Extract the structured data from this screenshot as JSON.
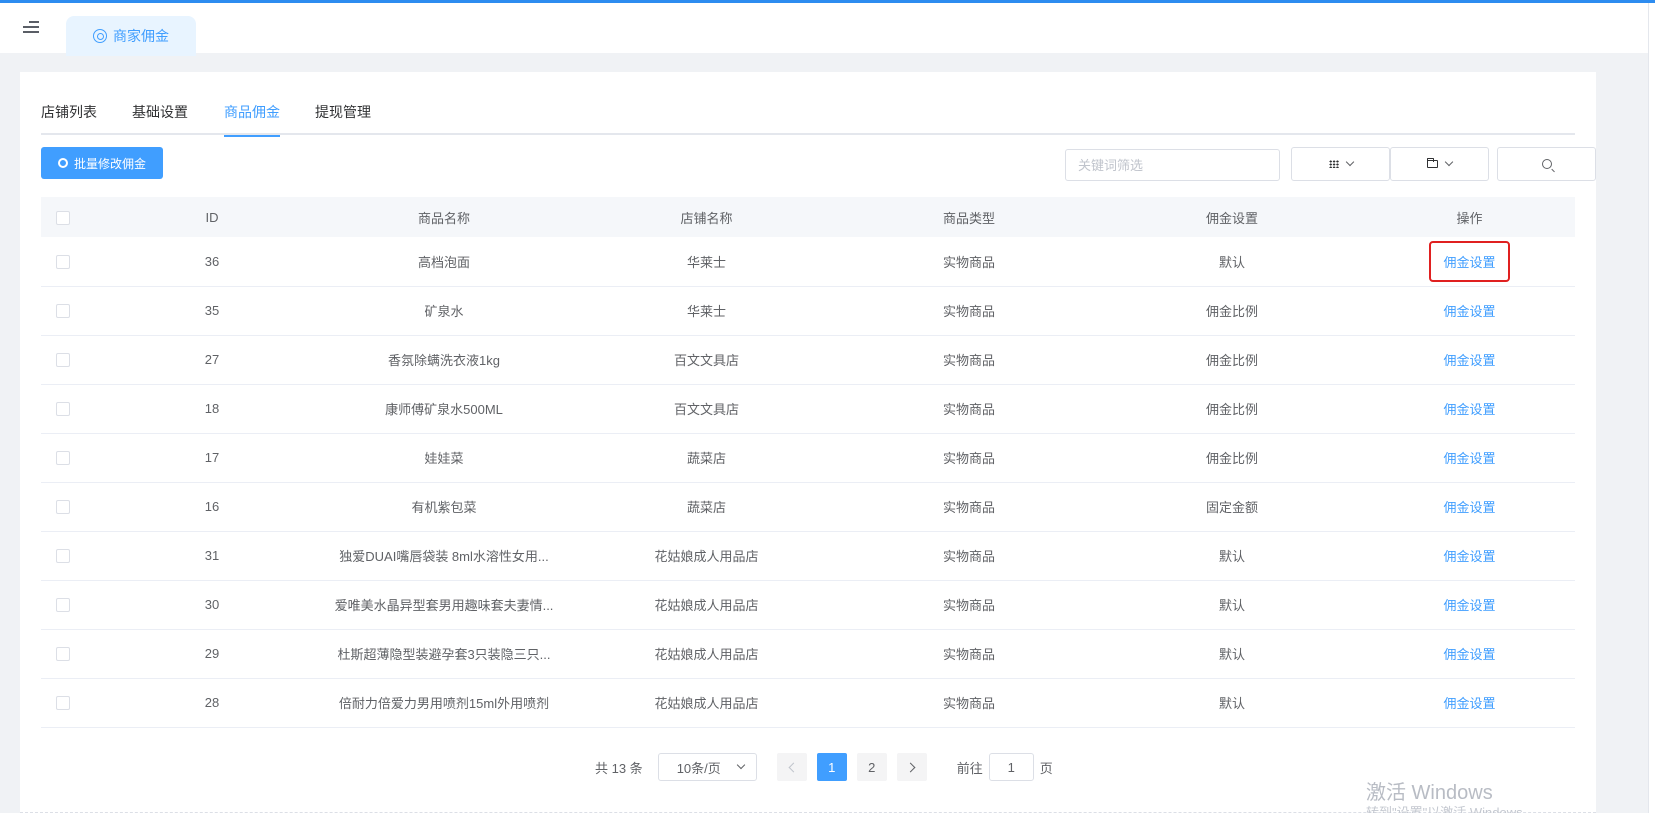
{
  "header": {
    "active_tab": "商家佣金"
  },
  "tabs": [
    "店铺列表",
    "基础设置",
    "商品佣金",
    "提现管理"
  ],
  "toolbar": {
    "batch_label": "批量修改佣金",
    "search_placeholder": "关键词筛选"
  },
  "table": {
    "columns": [
      "ID",
      "商品名称",
      "店铺名称",
      "商品类型",
      "佣金设置",
      "操作"
    ],
    "action_label": "佣金设置",
    "rows": [
      {
        "id": "36",
        "name": "高档泡面",
        "shop": "华莱士",
        "type": "实物商品",
        "commission": "默认"
      },
      {
        "id": "35",
        "name": "矿泉水",
        "shop": "华莱士",
        "type": "实物商品",
        "commission": "佣金比例"
      },
      {
        "id": "27",
        "name": "香氛除螨洗衣液1kg",
        "shop": "百文文具店",
        "type": "实物商品",
        "commission": "佣金比例"
      },
      {
        "id": "18",
        "name": "康师傅矿泉水500ML",
        "shop": "百文文具店",
        "type": "实物商品",
        "commission": "佣金比例"
      },
      {
        "id": "17",
        "name": "娃娃菜",
        "shop": "蔬菜店",
        "type": "实物商品",
        "commission": "佣金比例"
      },
      {
        "id": "16",
        "name": "有机紫包菜",
        "shop": "蔬菜店",
        "type": "实物商品",
        "commission": "固定金额"
      },
      {
        "id": "31",
        "name": "独爱DUAI嘴唇袋装 8ml水溶性女用...",
        "shop": "花姑娘成人用品店",
        "type": "实物商品",
        "commission": "默认"
      },
      {
        "id": "30",
        "name": "爱唯美水晶异型套男用趣味套夫妻情...",
        "shop": "花姑娘成人用品店",
        "type": "实物商品",
        "commission": "默认"
      },
      {
        "id": "29",
        "name": "杜斯超薄隐型装避孕套3只装隐三只...",
        "shop": "花姑娘成人用品店",
        "type": "实物商品",
        "commission": "默认"
      },
      {
        "id": "28",
        "name": "倍耐力倍爱力男用喷剂15ml外用喷剂",
        "shop": "花姑娘成人用品店",
        "type": "实物商品",
        "commission": "默认"
      }
    ]
  },
  "pagination": {
    "total": "共 13 条",
    "page_size": "10条/页",
    "pages": [
      "1",
      "2"
    ],
    "current_page": "1",
    "goto_label": "前往",
    "goto_value": "1",
    "page_suffix": "页"
  },
  "watermark": {
    "line1": "激活 Windows",
    "line2": "转到\"设置\"以激活 Windows。"
  },
  "colors": {
    "primary": "#409eff",
    "highlight_border": "#e02020"
  }
}
